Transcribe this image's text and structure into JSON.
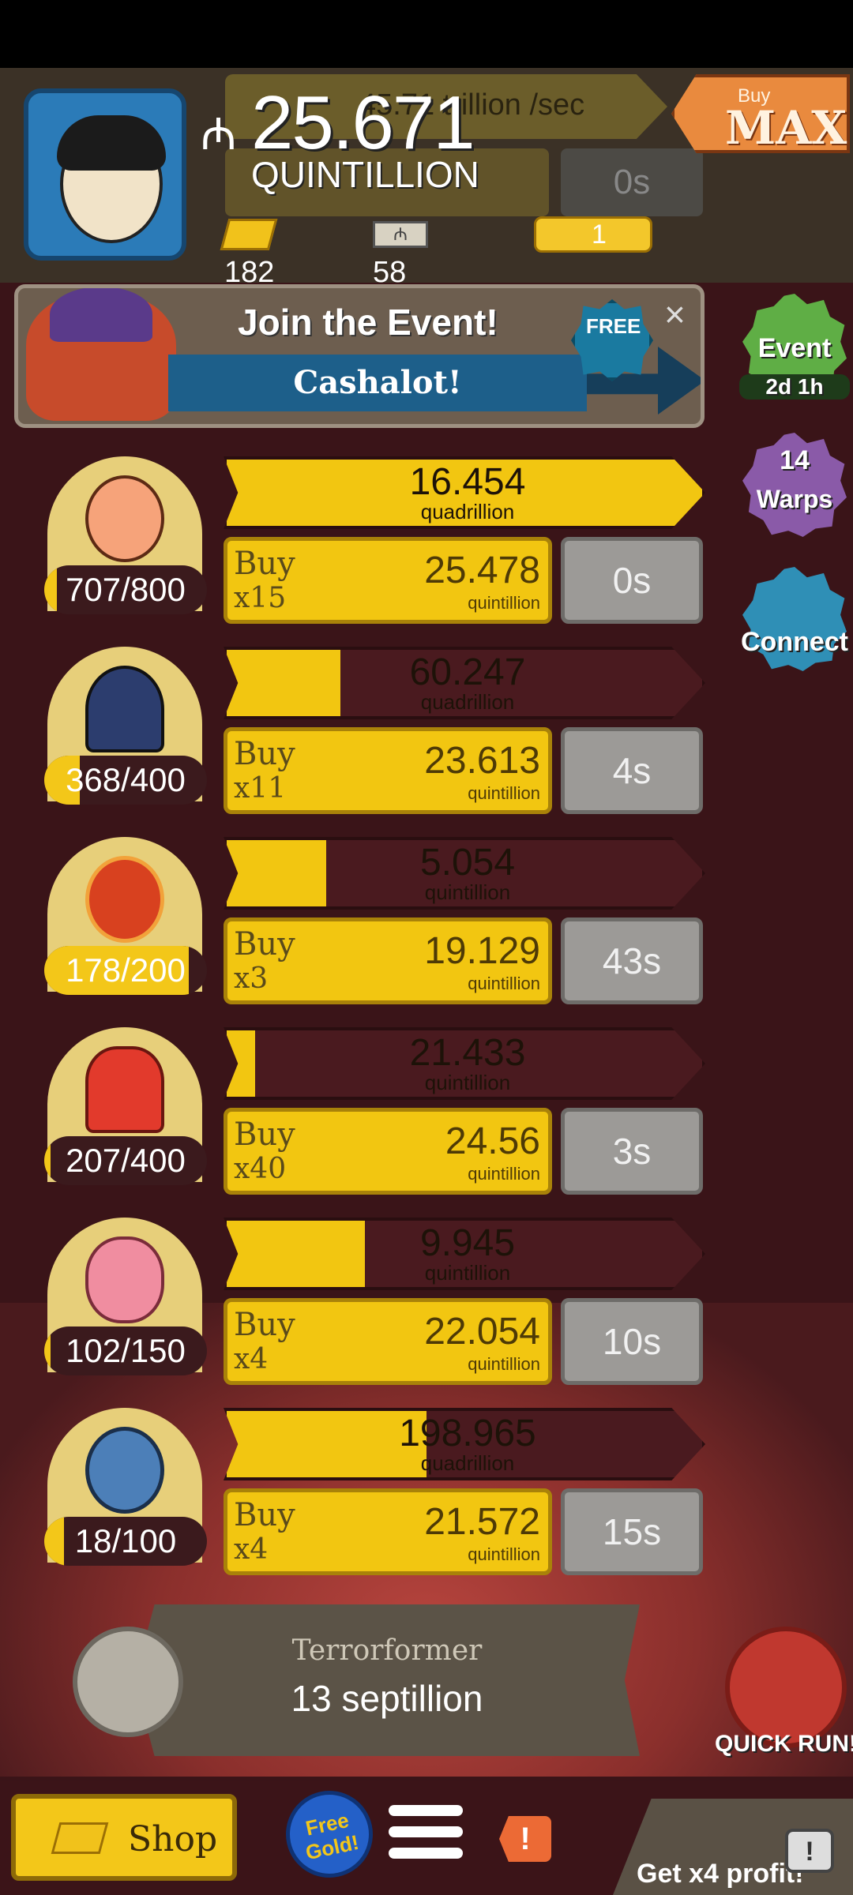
{
  "header": {
    "currency_symbol": "₼",
    "money_value": "25.671",
    "money_unit": "QUINTILLION",
    "income_rate": "45.71 trillion /sec",
    "buy_max_small": "Buy",
    "buy_max_big": "MAX",
    "ghost_timer": "0s",
    "gold": "182",
    "megabucks": "58",
    "tickets": "1"
  },
  "event_banner": {
    "title": "Join the Event!",
    "subtitle": "Cashalot!",
    "free_label": "FREE"
  },
  "side": {
    "event_label": "Event",
    "event_timer": "2d 1h",
    "warps_count": "14",
    "warps_label": "Warps",
    "connect_label": "Connect"
  },
  "businesses": [
    {
      "count": "707/800",
      "count_progress": 0.08,
      "profit": "16.454",
      "profit_unit": "quadrillion",
      "cycle_progress": 1.0,
      "buy_label": "Buy",
      "buy_qty": "x15",
      "cost": "25.478",
      "cost_unit": "quintillion",
      "timer": "0s"
    },
    {
      "count": "368/400",
      "count_progress": 0.22,
      "profit": "60.247",
      "profit_unit": "quadrillion",
      "cycle_progress": 0.24,
      "buy_label": "Buy",
      "buy_qty": "x11",
      "cost": "23.613",
      "cost_unit": "quintillion",
      "timer": "4s"
    },
    {
      "count": "178/200",
      "count_progress": 0.89,
      "profit": "5.054",
      "profit_unit": "quintillion",
      "cycle_progress": 0.21,
      "buy_label": "Buy",
      "buy_qty": "x3",
      "cost": "19.129",
      "cost_unit": "quintillion",
      "timer": "43s"
    },
    {
      "count": "207/400",
      "count_progress": 0.04,
      "profit": "21.433",
      "profit_unit": "quintillion",
      "cycle_progress": 0.06,
      "buy_label": "Buy",
      "buy_qty": "x40",
      "cost": "24.56",
      "cost_unit": "quintillion",
      "timer": "3s"
    },
    {
      "count": "102/150",
      "count_progress": 0.04,
      "profit": "9.945",
      "profit_unit": "quintillion",
      "cycle_progress": 0.29,
      "buy_label": "Buy",
      "buy_qty": "x4",
      "cost": "22.054",
      "cost_unit": "quintillion",
      "timer": "10s"
    },
    {
      "count": "18/100",
      "count_progress": 0.12,
      "profit": "198.965",
      "profit_unit": "quadrillion",
      "cycle_progress": 0.42,
      "buy_label": "Buy",
      "buy_qty": "x4",
      "cost": "21.572",
      "cost_unit": "quintillion",
      "timer": "15s"
    }
  ],
  "next_unlock": {
    "name": "Terrorformer",
    "amount": "13 septillion"
  },
  "quick_run_label": "QUICK RUN!",
  "bottom": {
    "shop_label": "Shop",
    "free_gold_label": "Free Gold!",
    "alert_glyph": "!",
    "x4_label": "Get x4 profit!",
    "tv_glyph": "!"
  },
  "colors": {
    "bar_yellow": "#f2c611",
    "background": "#3a1418",
    "timer_gray": "#9c9a97"
  }
}
